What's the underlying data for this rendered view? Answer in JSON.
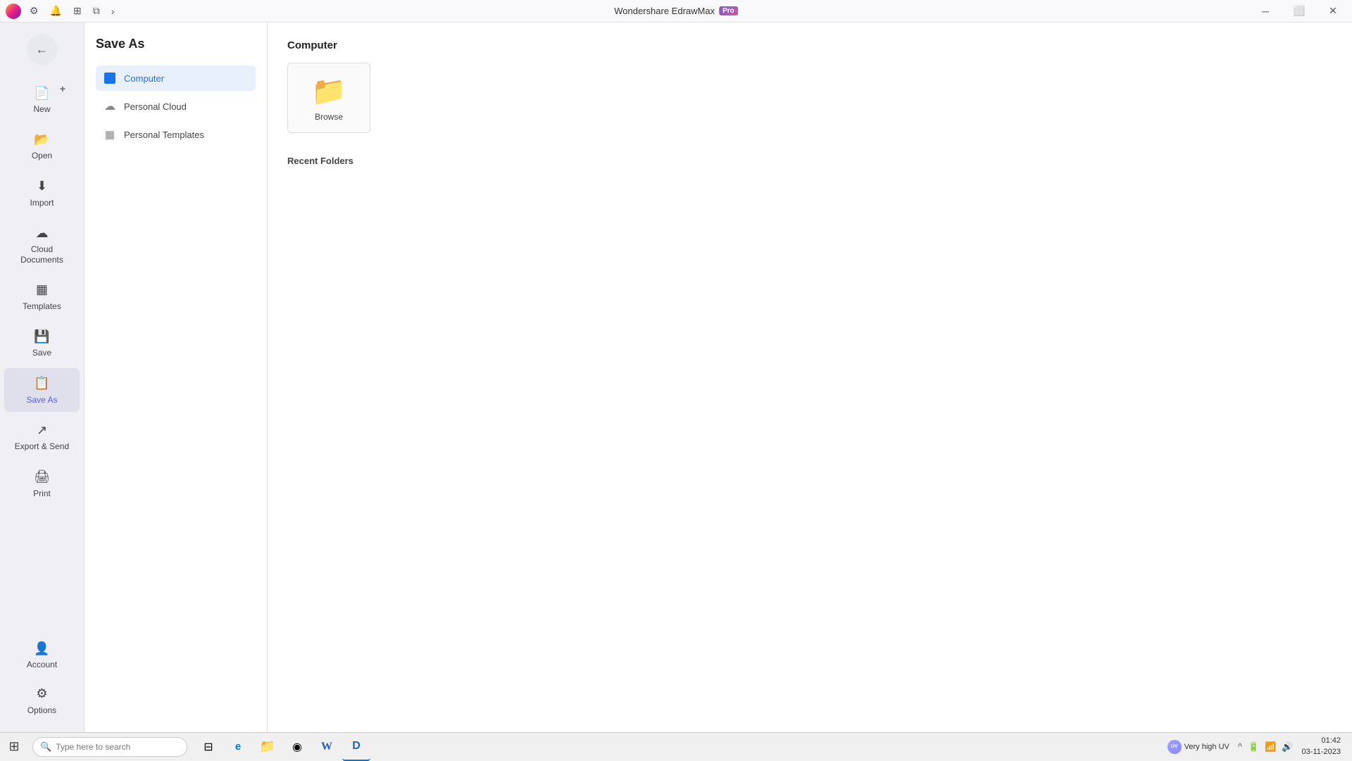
{
  "titlebar": {
    "app_name": "Wondershare EdrawMax",
    "pro_label": "Pro",
    "minimize_label": "─",
    "maximize_label": "⬜",
    "close_label": "✕"
  },
  "toolbar": {
    "settings_icon": "⚙",
    "bell_icon": "🔔",
    "grid_icon": "⊞",
    "copy_icon": "⧉",
    "arrow_icon": "›"
  },
  "left_nav": {
    "back_icon": "←",
    "items": [
      {
        "id": "new",
        "label": "New",
        "icon": "＋"
      },
      {
        "id": "open",
        "label": "Open",
        "icon": "📂"
      },
      {
        "id": "import",
        "label": "Import",
        "icon": "⬇"
      },
      {
        "id": "cloud",
        "label": "Cloud Documents",
        "icon": "☁"
      },
      {
        "id": "templates",
        "label": "Templates",
        "icon": "▦"
      },
      {
        "id": "save",
        "label": "Save",
        "icon": "💾"
      },
      {
        "id": "saveas",
        "label": "Save As",
        "icon": "📋"
      },
      {
        "id": "export",
        "label": "Export & Send",
        "icon": "↗"
      },
      {
        "id": "print",
        "label": "Print",
        "icon": "🖨"
      }
    ],
    "bottom_items": [
      {
        "id": "account",
        "label": "Account",
        "icon": "👤"
      },
      {
        "id": "options",
        "label": "Options",
        "icon": "⚙"
      }
    ]
  },
  "saveas_panel": {
    "title": "Save As",
    "options": [
      {
        "id": "computer",
        "label": "Computer",
        "active": true
      },
      {
        "id": "personal_cloud",
        "label": "Personal Cloud",
        "active": false
      },
      {
        "id": "personal_templates",
        "label": "Personal Templates",
        "active": false
      }
    ]
  },
  "main_content": {
    "section_title": "Computer",
    "browse_card": {
      "label": "Browse",
      "folder_icon": "📁"
    },
    "recent_folders_title": "Recent Folders"
  },
  "taskbar": {
    "start_icon": "⊞",
    "search_placeholder": "Type here to search",
    "search_icon": "🔍",
    "apps": [
      {
        "id": "widgets",
        "icon": "⊟",
        "active": false
      },
      {
        "id": "edge",
        "icon": "◈",
        "active": false
      },
      {
        "id": "file-explorer",
        "icon": "📁",
        "active": false
      },
      {
        "id": "chrome",
        "icon": "◉",
        "active": false
      },
      {
        "id": "word",
        "icon": "W",
        "active": false
      },
      {
        "id": "edrawmax",
        "icon": "D",
        "active": true
      }
    ],
    "uv_label": "Very high UV",
    "uv_icon": "UV",
    "tray_icons": [
      "^",
      "🔋",
      "🔊"
    ],
    "time": "01:42",
    "date": "03-11-2023"
  }
}
